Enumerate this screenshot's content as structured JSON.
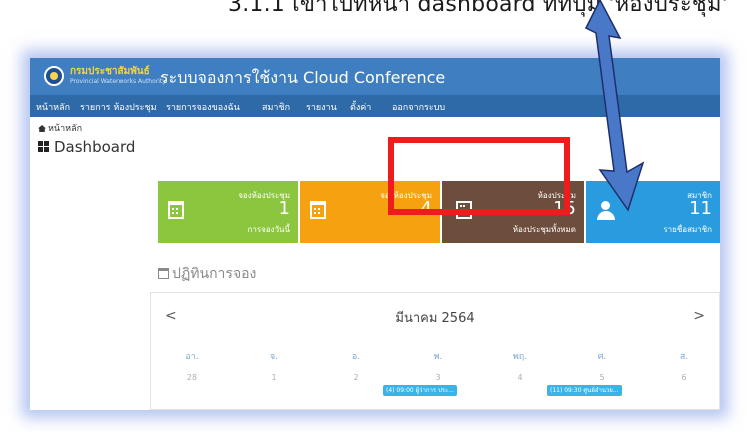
{
  "caption": "3.1.1 เข้าไปที่หน้า dashboard ที่ที่ปุ่ม 'ห้องประชุม'",
  "header": {
    "org_name": "กรมประชาสัมพันธ์",
    "org_sub": "Provincial Waterworks Authority",
    "app_title": "ระบบจองการใช้งาน Cloud Conference"
  },
  "nav": {
    "items": [
      "หน้าหลัก",
      "รายการ ห้องประชุม",
      "รายการจองของฉัน",
      "สมาชิก",
      "รายงาน",
      "ตั้งค่า",
      "ออกจากระบบ"
    ]
  },
  "breadcrumb": "หน้าหลัก",
  "page_title": "Dashboard",
  "cards": [
    {
      "label": "จองห้องประชุม",
      "value": "1",
      "sub": "การจองวันนี้",
      "color": "#8cc63e",
      "icon": "calendar-icon"
    },
    {
      "label": "จองห้องประชุม",
      "value": "4",
      "sub": "",
      "color": "#f5a110",
      "icon": "calendar-icon"
    },
    {
      "label": "ห้องประชุม",
      "value": "15",
      "sub": "ห้องประชุมทั้งหมด",
      "color": "#6d4e3c",
      "icon": "building-icon"
    },
    {
      "label": "สมาชิก",
      "value": "11",
      "sub": "รายชื่อสมาชิก",
      "color": "#2b9be0",
      "icon": "user-icon"
    }
  ],
  "section_title": "ปฏิทินการจอง",
  "calendar": {
    "month": "มีนาคม 2564",
    "prev": "<",
    "next": ">",
    "weekdays": [
      "อา.",
      "จ.",
      "อ.",
      "พ.",
      "พฤ.",
      "ศ.",
      "ส."
    ],
    "days": [
      "28",
      "1",
      "2",
      "3",
      "4",
      "5",
      "6"
    ],
    "events": [
      {
        "text": "(4) 09:00 ผู้ว่าการ ประ..."
      },
      {
        "text": "(11) 09:30 ศูนย์อำนวย..."
      }
    ]
  },
  "colors": {
    "header_bg": "#3f7fc1",
    "nav_bg": "#2f6aa8",
    "highlight": "#ee1c1c",
    "arrow": "#4a78c8"
  }
}
